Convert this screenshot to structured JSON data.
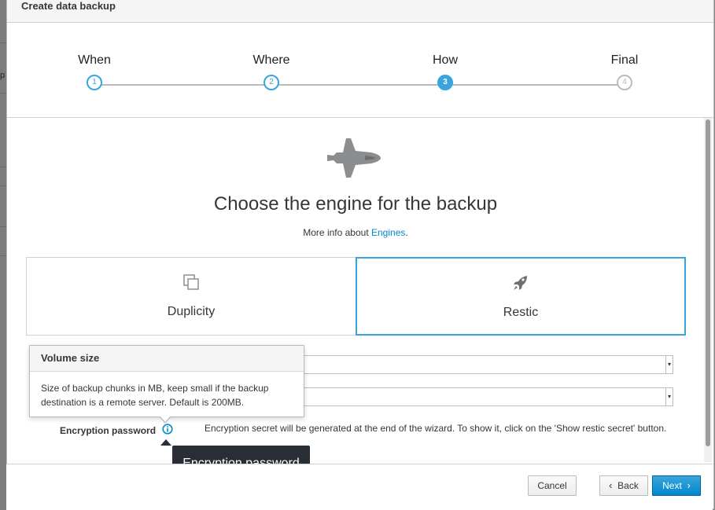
{
  "dialog": {
    "title": "Create data backup"
  },
  "steps": [
    {
      "label": "When",
      "number": "1",
      "state": "done"
    },
    {
      "label": "Where",
      "number": "2",
      "state": "done"
    },
    {
      "label": "How",
      "number": "3",
      "state": "active"
    },
    {
      "label": "Final",
      "number": "4",
      "state": "future"
    }
  ],
  "main": {
    "heading": "Choose the engine for the backup",
    "more_info_prefix": "More info about",
    "more_info_link": "Engines",
    "more_info_suffix": ".",
    "hero_icon": "space-shuttle-icon"
  },
  "engines": [
    {
      "label": "Duplicity",
      "icon": "copy-icon",
      "selected": false
    },
    {
      "label": "Restic",
      "icon": "rocket-icon",
      "selected": true
    }
  ],
  "fields": {
    "encryption_label": "Encryption password",
    "encryption_text": "Encryption secret will be generated at the end of the wizard. To show it, click on the 'Show restic secret' button."
  },
  "popover": {
    "title": "Volume size",
    "body": "Size of backup chunks in MB, keep small if the backup destination is a remote server. Default is 200MB."
  },
  "tooltip": {
    "text": "Encryption password"
  },
  "footer": {
    "cancel_label": "Cancel",
    "back_label": "Back",
    "next_label": "Next"
  },
  "colors": {
    "accent": "#39a5dc",
    "link": "#0088ce",
    "tooltip_bg": "#292e34"
  },
  "background": {
    "partial_text": "p"
  }
}
